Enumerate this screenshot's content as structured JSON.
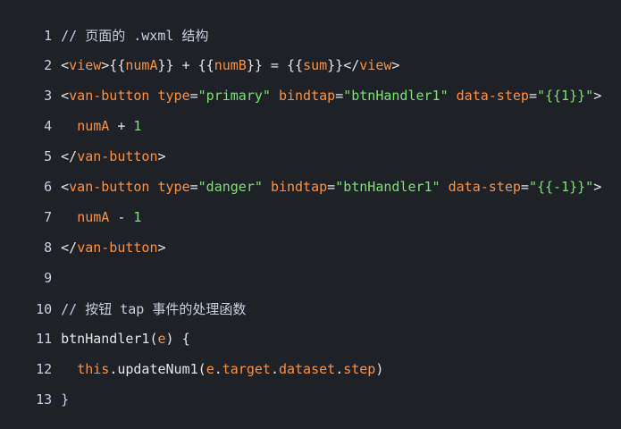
{
  "colors": {
    "background": "#1e2128",
    "tag": "#ff9140",
    "string": "#7ee072",
    "text": "#e6e6e6",
    "line_number": "#c9d1d9"
  },
  "lines": [
    {
      "num": "1",
      "text": "// 页面的 .wxml 结构"
    },
    {
      "num": "2",
      "text": "<view>{{numA}} + {{numB}} = {{sum}}</view>"
    },
    {
      "num": "3",
      "text": "<van-button type=\"primary\" bindtap=\"btnHandler1\" data-step=\"{{1}}\">"
    },
    {
      "num": "4",
      "text": "  numA + 1"
    },
    {
      "num": "5",
      "text": "</van-button>"
    },
    {
      "num": "6",
      "text": "<van-button type=\"danger\" bindtap=\"btnHandler1\" data-step=\"{{-1}}\">"
    },
    {
      "num": "7",
      "text": "  numA - 1"
    },
    {
      "num": "8",
      "text": "</van-button>"
    },
    {
      "num": "9",
      "text": ""
    },
    {
      "num": "10",
      "text": "// 按钮 tap 事件的处理函数"
    },
    {
      "num": "11",
      "text": "btnHandler1(e) {"
    },
    {
      "num": "12",
      "text": "  this.updateNum1(e.target.dataset.step)"
    },
    {
      "num": "13",
      "text": "}"
    }
  ]
}
